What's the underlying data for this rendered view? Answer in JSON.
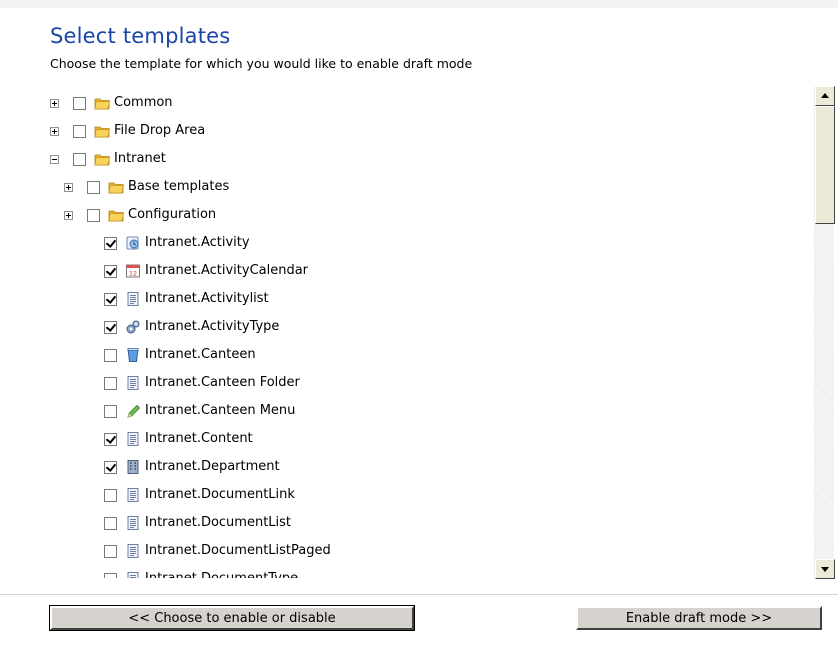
{
  "header": {
    "title": "Select templates",
    "subtitle": "Choose the template for which you would like to enable draft mode"
  },
  "tree": {
    "nodes": [
      {
        "label": "Common",
        "level": 0,
        "expander": "plus",
        "checked": false,
        "icon": "folder-icon"
      },
      {
        "label": "File Drop Area",
        "level": 0,
        "expander": "plus",
        "checked": false,
        "icon": "folder-icon"
      },
      {
        "label": "Intranet",
        "level": 0,
        "expander": "minus",
        "checked": false,
        "icon": "folder-icon"
      },
      {
        "label": "Base templates",
        "level": 1,
        "expander": "plus",
        "checked": false,
        "icon": "folder-icon"
      },
      {
        "label": "Configuration",
        "level": 1,
        "expander": "plus",
        "checked": false,
        "icon": "folder-icon"
      },
      {
        "label": "Intranet.Activity",
        "level": 2,
        "expander": "",
        "checked": true,
        "icon": "activity-icon"
      },
      {
        "label": "Intranet.ActivityCalendar",
        "level": 2,
        "expander": "",
        "checked": true,
        "icon": "calendar-icon"
      },
      {
        "label": "Intranet.Activitylist",
        "level": 2,
        "expander": "",
        "checked": true,
        "icon": "document-icon"
      },
      {
        "label": "Intranet.ActivityType",
        "level": 2,
        "expander": "",
        "checked": true,
        "icon": "gears-icon"
      },
      {
        "label": "Intranet.Canteen",
        "level": 2,
        "expander": "",
        "checked": false,
        "icon": "cup-icon"
      },
      {
        "label": "Intranet.Canteen Folder",
        "level": 2,
        "expander": "",
        "checked": false,
        "icon": "document-icon"
      },
      {
        "label": "Intranet.Canteen Menu",
        "level": 2,
        "expander": "",
        "checked": false,
        "icon": "pencil-icon"
      },
      {
        "label": "Intranet.Content",
        "level": 2,
        "expander": "",
        "checked": true,
        "icon": "document-icon"
      },
      {
        "label": "Intranet.Department",
        "level": 2,
        "expander": "",
        "checked": true,
        "icon": "building-icon"
      },
      {
        "label": "Intranet.DocumentLink",
        "level": 2,
        "expander": "",
        "checked": false,
        "icon": "document-icon"
      },
      {
        "label": "Intranet.DocumentList",
        "level": 2,
        "expander": "",
        "checked": false,
        "icon": "document-icon"
      },
      {
        "label": "Intranet.DocumentListPaged",
        "level": 2,
        "expander": "",
        "checked": false,
        "icon": "document-icon"
      },
      {
        "label": "Intranet.DocumentType",
        "level": 2,
        "expander": "",
        "checked": false,
        "icon": "document-icon"
      }
    ]
  },
  "buttons": {
    "back_label": "<< Choose to enable or disable",
    "next_label": "Enable draft mode >>"
  },
  "colors": {
    "title": "#1a46a8",
    "folder": "#f4c542",
    "button_face": "#d6d3ce"
  }
}
